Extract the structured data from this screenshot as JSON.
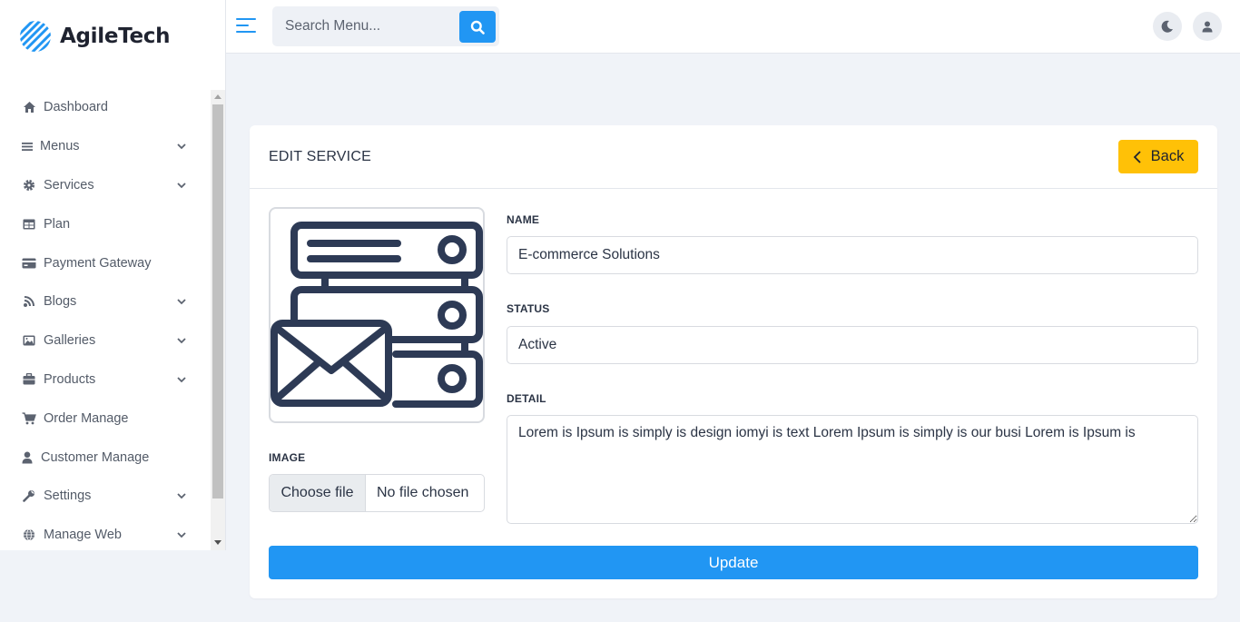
{
  "brand": {
    "name": "AgileTech",
    "logo_icon": "striped-globe-icon",
    "accent": "#2196f3"
  },
  "sidebar": {
    "items": [
      {
        "label": "Dashboard",
        "icon": "home-icon",
        "has_submenu": false
      },
      {
        "label": "Menus",
        "icon": "bars-icon",
        "has_submenu": true
      },
      {
        "label": "Services",
        "icon": "gear-icon",
        "has_submenu": true
      },
      {
        "label": "Plan",
        "icon": "table-icon",
        "has_submenu": false
      },
      {
        "label": "Payment Gateway",
        "icon": "credit-card-icon",
        "has_submenu": false
      },
      {
        "label": "Blogs",
        "icon": "blog-icon",
        "has_submenu": true
      },
      {
        "label": "Galleries",
        "icon": "image-icon",
        "has_submenu": true
      },
      {
        "label": "Products",
        "icon": "briefcase-icon",
        "has_submenu": true
      },
      {
        "label": "Order Manage",
        "icon": "cart-icon",
        "has_submenu": false
      },
      {
        "label": "Customer Manage",
        "icon": "user-icon",
        "has_submenu": false
      },
      {
        "label": "Settings",
        "icon": "wrench-icon",
        "has_submenu": true
      },
      {
        "label": "Manage Web",
        "icon": "globe-icon",
        "has_submenu": true
      }
    ]
  },
  "topbar": {
    "search": {
      "placeholder": "Search Menu..."
    }
  },
  "card": {
    "title": "EDIT SERVICE",
    "back_label": "Back",
    "image_label": "IMAGE",
    "file_button": "Choose file",
    "file_status": "No file chosen",
    "name_label": "NAME",
    "name_value": "E-commerce Solutions",
    "status_label": "STATUS",
    "status_value": "Active",
    "detail_label": "DETAIL",
    "detail_value": "Lorem is Ipsum is simply is design iomyi is text Lorem Ipsum is simply is our busi Lorem is Ipsum is",
    "update_label": "Update"
  },
  "colors": {
    "primary": "#2196f3",
    "back_button": "#ffc107",
    "icon_stroke": "#2d3a55"
  }
}
